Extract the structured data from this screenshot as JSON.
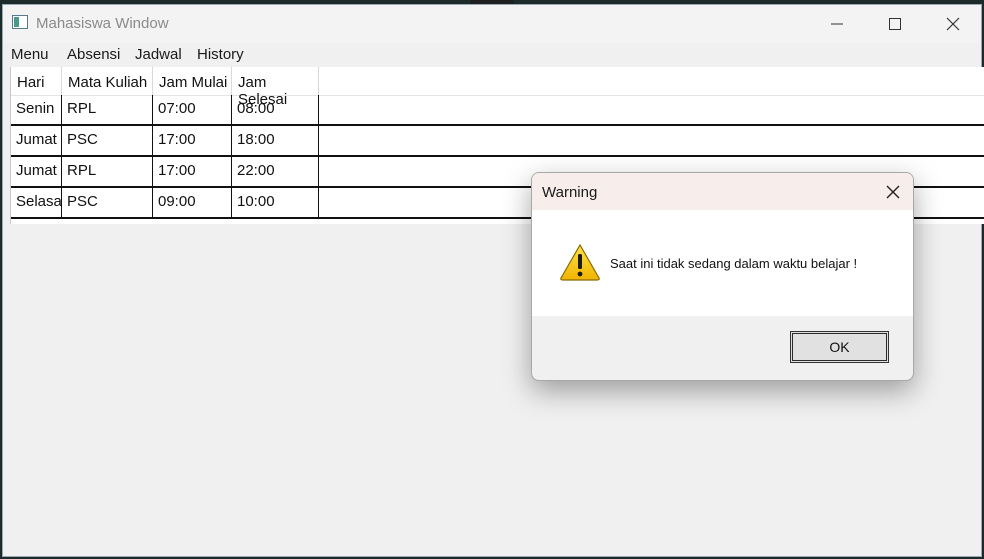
{
  "window": {
    "title": "Mahasiswa Window",
    "icons": {
      "app": "app-window-icon",
      "minimize": "minimize-icon",
      "maximize": "maximize-icon",
      "close": "close-icon"
    }
  },
  "menubar": {
    "items": [
      "Menu",
      "Absensi",
      "Jadwal",
      "History"
    ]
  },
  "grid": {
    "columns": [
      "Hari",
      "Mata Kuliah",
      "Jam Mulai",
      "Jam Selesai"
    ],
    "rows": [
      [
        "Senin",
        "RPL",
        "07:00",
        "08:00"
      ],
      [
        "Jumat",
        "PSC",
        "17:00",
        "18:00"
      ],
      [
        "Jumat",
        "RPL",
        "17:00",
        "22:00"
      ],
      [
        "Selasa",
        "PSC",
        "09:00",
        "10:00"
      ]
    ]
  },
  "dialog": {
    "title": "Warning",
    "message": "Saat ini tidak sedang dalam waktu belajar !",
    "ok_label": "OK",
    "icon": "warning-icon"
  },
  "colors": {
    "window_bg": "#f0f0f0",
    "dialog_title_bg": "#f7eeec",
    "warning_yellow": "#f5c400"
  }
}
